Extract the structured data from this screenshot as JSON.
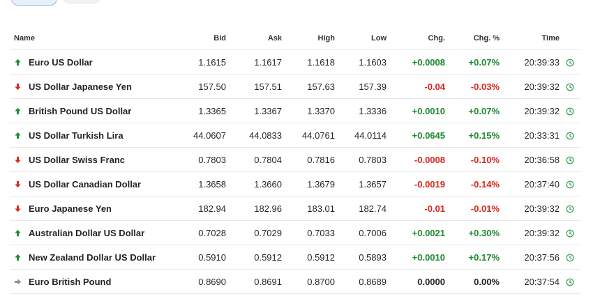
{
  "columns": {
    "name": "Name",
    "bid": "Bid",
    "ask": "Ask",
    "high": "High",
    "low": "Low",
    "chg": "Chg.",
    "chg_pct": "Chg. %",
    "time": "Time"
  },
  "colors": {
    "up": "#1d8a2f",
    "down": "#d9261c",
    "flat": "#8a8f98",
    "clock": "#2e9e45"
  },
  "rows": [
    {
      "name": "Euro US Dollar",
      "dir": "up",
      "bid": "1.1615",
      "ask": "1.1617",
      "high": "1.1618",
      "low": "1.1603",
      "chg": "+0.0008",
      "chg_pct": "+0.07%",
      "time": "20:39:33"
    },
    {
      "name": "US Dollar Japanese Yen",
      "dir": "down",
      "bid": "157.50",
      "ask": "157.51",
      "high": "157.63",
      "low": "157.39",
      "chg": "-0.04",
      "chg_pct": "-0.03%",
      "time": "20:39:32"
    },
    {
      "name": "British Pound US Dollar",
      "dir": "up",
      "bid": "1.3365",
      "ask": "1.3367",
      "high": "1.3370",
      "low": "1.3336",
      "chg": "+0.0010",
      "chg_pct": "+0.07%",
      "time": "20:39:32"
    },
    {
      "name": "US Dollar Turkish Lira",
      "dir": "up",
      "bid": "44.0607",
      "ask": "44.0833",
      "high": "44.0761",
      "low": "44.0114",
      "chg": "+0.0645",
      "chg_pct": "+0.15%",
      "time": "20:33:31"
    },
    {
      "name": "US Dollar Swiss Franc",
      "dir": "down",
      "bid": "0.7803",
      "ask": "0.7804",
      "high": "0.7816",
      "low": "0.7803",
      "chg": "-0.0008",
      "chg_pct": "-0.10%",
      "time": "20:36:58"
    },
    {
      "name": "US Dollar Canadian Dollar",
      "dir": "down",
      "bid": "1.3658",
      "ask": "1.3660",
      "high": "1.3679",
      "low": "1.3657",
      "chg": "-0.0019",
      "chg_pct": "-0.14%",
      "time": "20:37:40"
    },
    {
      "name": "Euro Japanese Yen",
      "dir": "down",
      "bid": "182.94",
      "ask": "182.96",
      "high": "183.01",
      "low": "182.74",
      "chg": "-0.01",
      "chg_pct": "-0.01%",
      "time": "20:39:32"
    },
    {
      "name": "Australian Dollar US Dollar",
      "dir": "up",
      "bid": "0.7028",
      "ask": "0.7029",
      "high": "0.7033",
      "low": "0.7006",
      "chg": "+0.0021",
      "chg_pct": "+0.30%",
      "time": "20:39:32"
    },
    {
      "name": "New Zealand Dollar US Dollar",
      "dir": "up",
      "bid": "0.5910",
      "ask": "0.5912",
      "high": "0.5912",
      "low": "0.5893",
      "chg": "+0.0010",
      "chg_pct": "+0.17%",
      "time": "20:37:56"
    },
    {
      "name": "Euro British Pound",
      "dir": "flat",
      "bid": "0.8690",
      "ask": "0.8691",
      "high": "0.8700",
      "low": "0.8689",
      "chg": "0.0000",
      "chg_pct": "0.00%",
      "time": "20:37:54"
    }
  ]
}
